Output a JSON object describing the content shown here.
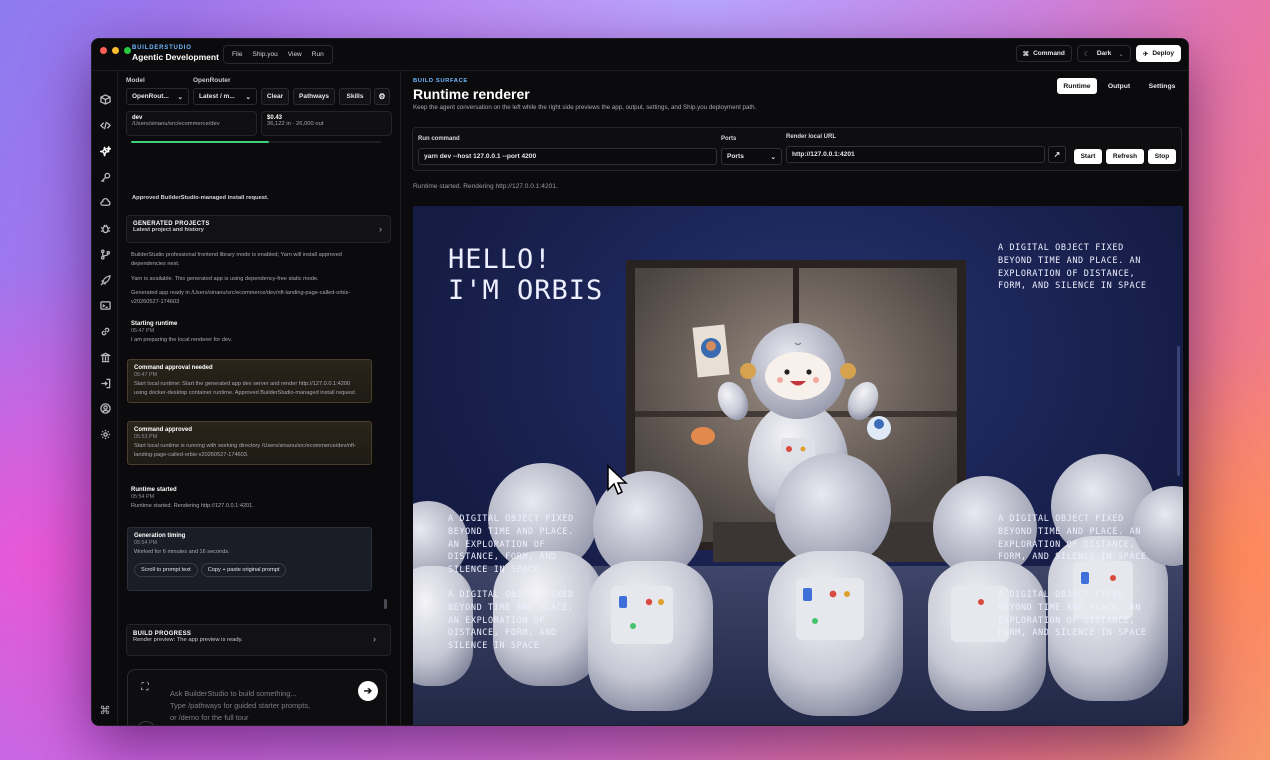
{
  "app": {
    "brand_small": "BUILDERSTUDIO",
    "brand_title": "Agentic Development",
    "menu": [
      "File",
      "Ship.you",
      "View",
      "Run"
    ],
    "command_label": "Command",
    "theme_label": "Dark",
    "deploy_label": "Deploy"
  },
  "left": {
    "model_label": "Model",
    "openrouter_label": "OpenRouter",
    "model_value": "OpenRout...",
    "openrouter_value": "Latest / m...",
    "clear_label": "Clear",
    "pathways_label": "Pathways",
    "skills_label": "Skills",
    "branch": "dev",
    "path": "/Users/sinanu/src/ecommerce/dev",
    "cost": "$0.43",
    "tokens": "36,122 in · 26,000 out",
    "progress": 0.55,
    "approved_note": "Approved BuilderStudio-managed install request.",
    "generated_title": "GENERATED PROJECTS",
    "generated_sub": "Latest project and history",
    "feed": {
      "m1": "BuilderStudio professional frontend library mode is enabled; Yarn will install approved dependencies next.",
      "m2": "Yarn is available. This generated app is using dependency-free static mode.",
      "m3": "Generated app ready in /Users/sinanu/src/ecommerce/dev/nft-landing-page-called-orbis-v20260527-174603",
      "starting_title": "Starting runtime",
      "starting_time": "05:47 PM",
      "starting_text": "I am preparing the local renderer for dev.",
      "approval_title": "Command approval needed",
      "approval_time": "05:47 PM",
      "approval_text": "Start local runtime: Start the generated app dev server and render http://127.0.0.1:4200 using docker-desktop container runtime. Approved BuilderStudio-managed install request.",
      "approved_title": "Command approved",
      "approved_time": "05:53 PM",
      "approved_text": "Start local runtime is running with working directory /Users/sinanu/src/ecommerce/dev/nft-landing-page-called-orbis-v20260527-174603.",
      "started_title": "Runtime started",
      "started_time": "05:54 PM",
      "started_text": "Runtime started. Rendering http://127.0.0.1:4201.",
      "timing_title": "Generation timing",
      "timing_time": "05:54 PM",
      "timing_text": "Worked for 6 minutes and 16 seconds.",
      "scroll_btn": "Scroll to prompt text",
      "copy_btn": "Copy + paste original prompt"
    },
    "build_title": "BUILD PROGRESS",
    "build_sub": "Render preview: The app preview is ready.",
    "prompt_placeholder_1": "Ask BuilderStudio to build something...",
    "prompt_placeholder_2": "Type /pathways for guided starter prompts,",
    "prompt_placeholder_3": "or /demo for the full tour"
  },
  "right": {
    "eyebrow": "BUILD SURFACE",
    "title": "Runtime renderer",
    "subtitle": "Keep the agent conversation on the left while the right side previews the app, output, settings, and Ship.you deployment path.",
    "tabs": [
      "Runtime",
      "Output",
      "Settings"
    ],
    "run_command_label": "Run command",
    "run_command_value": "yarn dev --host 127.0.0.1 --port 4200",
    "ports_label": "Ports",
    "ports_value": "Ports",
    "render_url_label": "Render local URL",
    "render_url_value": "http://127.0.0.1:4201",
    "start_label": "Start",
    "refresh_label": "Refresh",
    "stop_label": "Stop",
    "status_line": "Runtime started. Rendering http://127.0.0.1:4201."
  },
  "preview": {
    "hello_line1": "HELLO!",
    "hello_line2": "I'M ORBIS",
    "tagline": "A DIGITAL OBJECT FIXED BEYOND TIME AND PLACE. AN EXPLORATION OF DISTANCE, FORM, AND SILENCE IN SPACE"
  }
}
